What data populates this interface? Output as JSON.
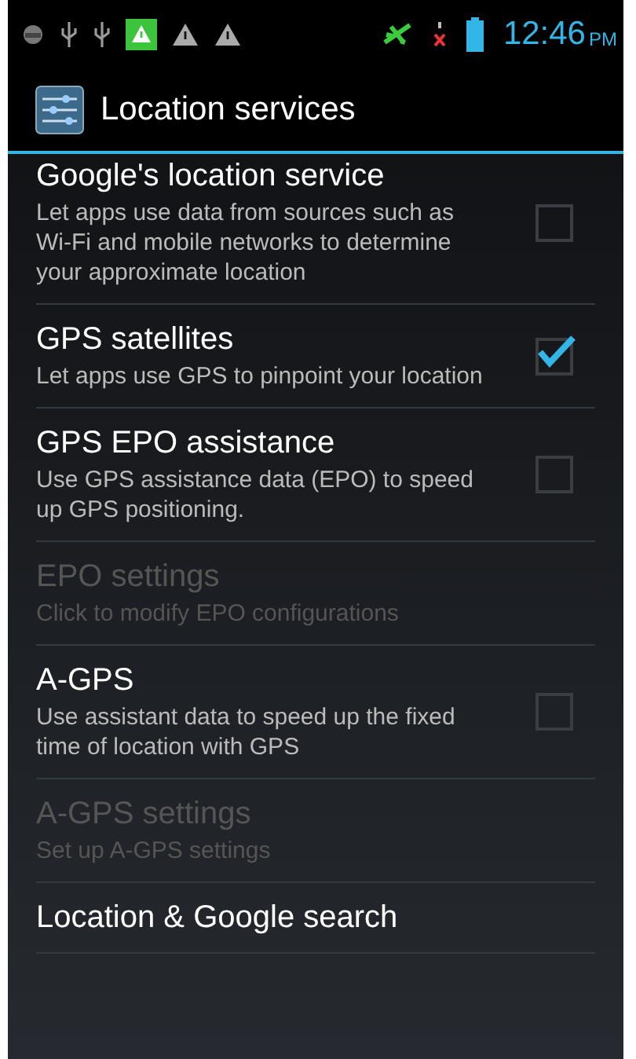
{
  "status_bar": {
    "time": "12:46",
    "meridiem": "PM"
  },
  "action_bar": {
    "title": "Location services"
  },
  "settings": [
    {
      "kind": "checkbox",
      "title": "Google's location service",
      "summary": "Let apps use data from sources such as Wi-Fi and mobile networks to determine your approximate location",
      "checked": false,
      "disabled": false
    },
    {
      "kind": "checkbox",
      "title": "GPS satellites",
      "summary": "Let apps use GPS to pinpoint your location",
      "checked": true,
      "disabled": false
    },
    {
      "kind": "checkbox",
      "title": "GPS EPO assistance",
      "summary": "Use GPS assistance data (EPO) to speed up GPS positioning.",
      "checked": false,
      "disabled": false
    },
    {
      "kind": "plain",
      "title": "EPO settings",
      "summary": "Click to modify EPO configurations",
      "disabled": true
    },
    {
      "kind": "checkbox",
      "title": "A-GPS",
      "summary": "Use assistant data to speed up the fixed time of location with GPS",
      "checked": false,
      "disabled": false
    },
    {
      "kind": "plain",
      "title": "A-GPS settings",
      "summary": "Set up A-GPS settings",
      "disabled": true
    },
    {
      "kind": "plain",
      "title": "Location & Google search",
      "disabled": false
    }
  ]
}
